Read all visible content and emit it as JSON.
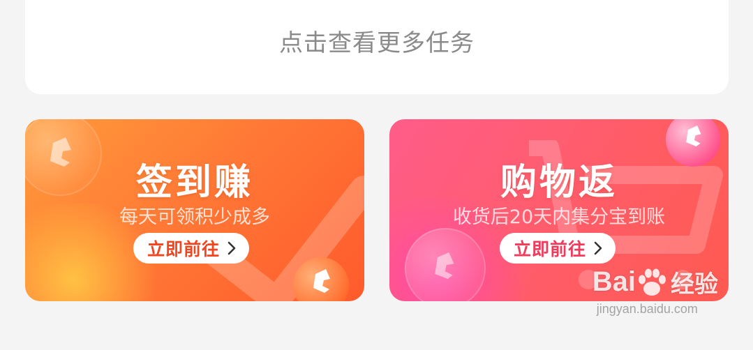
{
  "more_tasks": {
    "label": "点击查看更多任务"
  },
  "promos": [
    {
      "title": "签到赚",
      "subtitle": "每天可领积少成多",
      "cta_label": "立即前往",
      "colors": {
        "start": "#ff9c3a",
        "end": "#ff5a2c",
        "cta_text": "#f0451f"
      }
    },
    {
      "title": "购物返",
      "subtitle": "收货后20天内集分宝到账",
      "cta_label": "立即前往",
      "colors": {
        "start": "#ff5c8a",
        "end": "#ff5a50",
        "cta_text": "#f23a5a"
      }
    }
  ],
  "icons": {
    "cta_arrow": "chevron-right-icon",
    "coin": "coin-icon",
    "check": "checkmark-icon",
    "cart": "shopping-cart-icon"
  },
  "watermark": {
    "brand": "Bai",
    "brand_suffix": "经验",
    "url": "jingyan.baidu.com"
  }
}
